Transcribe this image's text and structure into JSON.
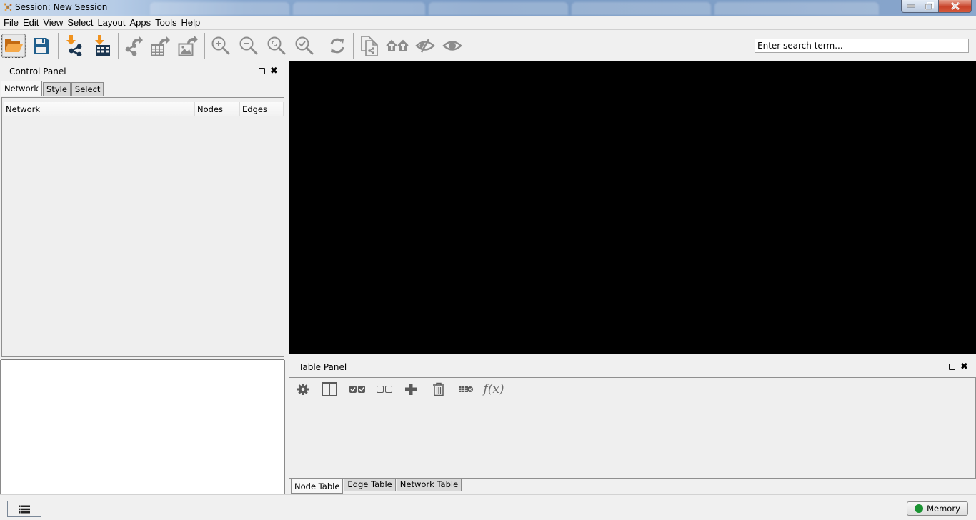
{
  "window": {
    "title": "Session: New Session",
    "controls": [
      "minimize",
      "restore",
      "close"
    ]
  },
  "menubar": {
    "items": [
      "File",
      "Edit",
      "View",
      "Select",
      "Layout",
      "Apps",
      "Tools",
      "Help"
    ]
  },
  "toolbar": {
    "buttons": [
      {
        "name": "open-session",
        "icon": "folder-open-icon"
      },
      {
        "name": "save-session",
        "icon": "floppy-disk-icon"
      },
      {
        "name": "import-network",
        "icon": "import-network-icon"
      },
      {
        "name": "import-table",
        "icon": "import-table-icon"
      },
      {
        "name": "export-network",
        "icon": "export-network-icon"
      },
      {
        "name": "export-table",
        "icon": "export-table-icon"
      },
      {
        "name": "export-image",
        "icon": "export-image-icon"
      },
      {
        "name": "zoom-in",
        "icon": "zoom-in-icon"
      },
      {
        "name": "zoom-out",
        "icon": "zoom-out-icon"
      },
      {
        "name": "zoom-fit",
        "icon": "zoom-fit-icon"
      },
      {
        "name": "zoom-selected",
        "icon": "zoom-selected-icon"
      },
      {
        "name": "apply-layout",
        "icon": "refresh-icon"
      },
      {
        "name": "new-network-from-selection",
        "icon": "new-network-from-selection-icon"
      },
      {
        "name": "first-neighbors",
        "icon": "houses-icon"
      },
      {
        "name": "hide-selected",
        "icon": "eye-slash-icon"
      },
      {
        "name": "show-all",
        "icon": "eye-icon"
      }
    ],
    "search": {
      "placeholder": "Enter search term..."
    }
  },
  "control_panel": {
    "title": "Control Panel",
    "tabs": [
      {
        "label": "Network",
        "active": true
      },
      {
        "label": "Style",
        "active": false
      },
      {
        "label": "Select",
        "active": false
      }
    ],
    "table_columns": [
      "Network",
      "Nodes",
      "Edges"
    ],
    "rows": []
  },
  "table_panel": {
    "title": "Table Panel",
    "tools": [
      {
        "name": "table-options",
        "icon": "gear-icon"
      },
      {
        "name": "show-columns",
        "icon": "columns-icon"
      },
      {
        "name": "select-all-columns",
        "icon": "checked-boxes-icon"
      },
      {
        "name": "deselect-all-columns",
        "icon": "empty-boxes-icon"
      },
      {
        "name": "create-column",
        "icon": "plus-icon"
      },
      {
        "name": "delete-columns",
        "icon": "trash-icon"
      },
      {
        "name": "delete-table",
        "icon": "table-delete-icon"
      },
      {
        "name": "function-builder",
        "icon": "function-icon",
        "label": "f(x)"
      }
    ],
    "tabs": [
      {
        "label": "Node Table",
        "active": true
      },
      {
        "label": "Edge Table",
        "active": false
      },
      {
        "label": "Network Table",
        "active": false
      }
    ]
  },
  "statusbar": {
    "tasks_icon": "list-icon",
    "memory_label": "Memory",
    "memory_status_color": "#1a9332"
  },
  "colors": {
    "accent_orange": "#f0921e",
    "icon_navy": "#1f4e79",
    "icon_grey": "#8a8a8a",
    "canvas_background": "#000000"
  }
}
